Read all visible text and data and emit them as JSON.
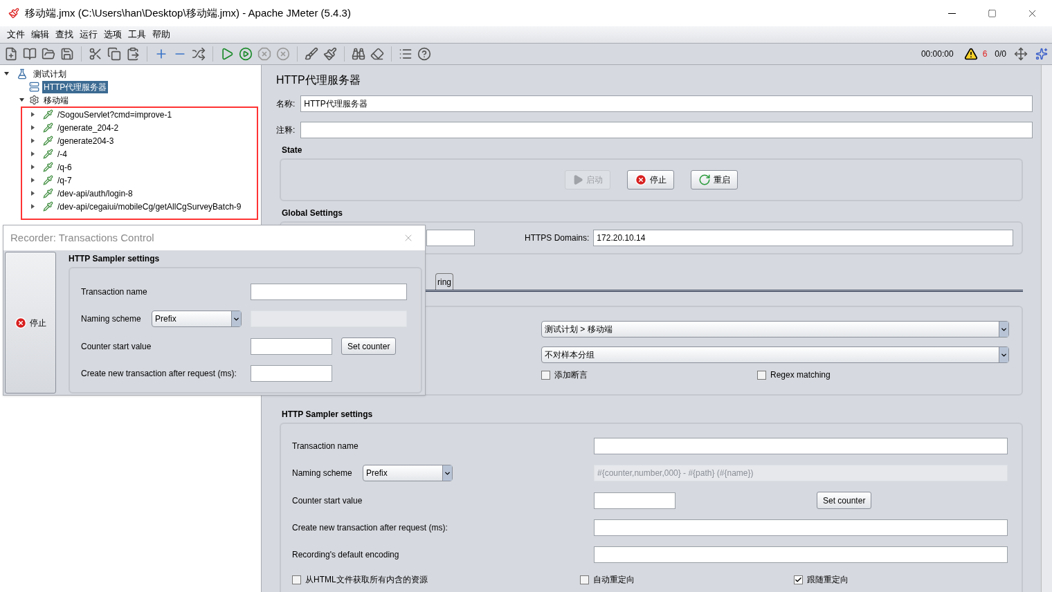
{
  "window": {
    "title": "移动端.jmx (C:\\Users\\han\\Desktop\\移动端.jmx) - Apache JMeter (5.4.3)"
  },
  "menu": [
    "文件",
    "编辑",
    "查找",
    "运行",
    "选项",
    "工具",
    "帮助"
  ],
  "status": {
    "timer": "00:00:00",
    "warnings": "6",
    "threads": "0/0"
  },
  "tree": {
    "label": "测试计划",
    "expanded": true,
    "children": [
      {
        "label": "HTTP代理服务器",
        "kind": "proxy",
        "selected": true
      },
      {
        "label": "移动端",
        "kind": "controller",
        "selected": false,
        "expanded": true,
        "children": [
          {
            "label": "/SogouServlet?cmd=improve-1",
            "selected": false
          },
          {
            "label": "/generate_204-2",
            "selected": false
          },
          {
            "label": "/generate204-3",
            "selected": false
          },
          {
            "label": "/-4",
            "selected": false
          },
          {
            "label": "/q-6",
            "selected": false
          },
          {
            "label": "/q-7",
            "selected": false
          },
          {
            "label": "/dev-api/auth/login-8",
            "selected": false
          },
          {
            "label": "/dev-api/cegaiui/mobileCg/getAllCgSurveyBatch-9",
            "selected": false
          }
        ]
      }
    ]
  },
  "panel": {
    "title": "HTTP代理服务器",
    "name_label": "名称:",
    "name_value": "HTTP代理服务器",
    "comment_label": "注释:",
    "state": {
      "title": "State",
      "buttons": [
        {
          "label": "启动",
          "kind": "start",
          "disabled": true
        },
        {
          "label": "停止",
          "kind": "stop",
          "disabled": false
        },
        {
          "label": "重启",
          "kind": "restart",
          "disabled": false
        }
      ]
    },
    "global": {
      "title": "Global Settings",
      "https_label": "HTTPS Domains:",
      "https_value": "172.20.10.14"
    },
    "tab_fragment": "ring",
    "target": "测试计划 > 移动端",
    "grouping": "不对样本分组",
    "options": [
      {
        "label": "添加断言",
        "checked": false
      },
      {
        "label": "Regex matching",
        "checked": false
      }
    ],
    "sampler": {
      "title": "HTTP Sampler settings",
      "transaction_label": "Transaction name",
      "naming_label": "Naming scheme",
      "naming_value": "Prefix",
      "format_value": "#{counter,number,000} - #{path} (#{name})",
      "counter_label": "Counter start value",
      "set_counter": "Set counter",
      "create_label": "Create new transaction after request (ms):",
      "encoding_label": "Recording's default encoding",
      "checkboxes": [
        {
          "label": "从HTML文件获取所有内含的资源",
          "checked": false
        },
        {
          "label": "自动重定向",
          "checked": false
        },
        {
          "label": "跟随重定向",
          "checked": true
        }
      ]
    }
  },
  "dialog": {
    "title": "Recorder: Transactions Control",
    "stop": "停止",
    "section": "HTTP Sampler settings",
    "transaction_label": "Transaction name",
    "naming_label": "Naming scheme",
    "naming_value": "Prefix",
    "counter_label": "Counter start value",
    "set_counter": "Set counter",
    "create_label": "Create new transaction after request (ms):"
  }
}
